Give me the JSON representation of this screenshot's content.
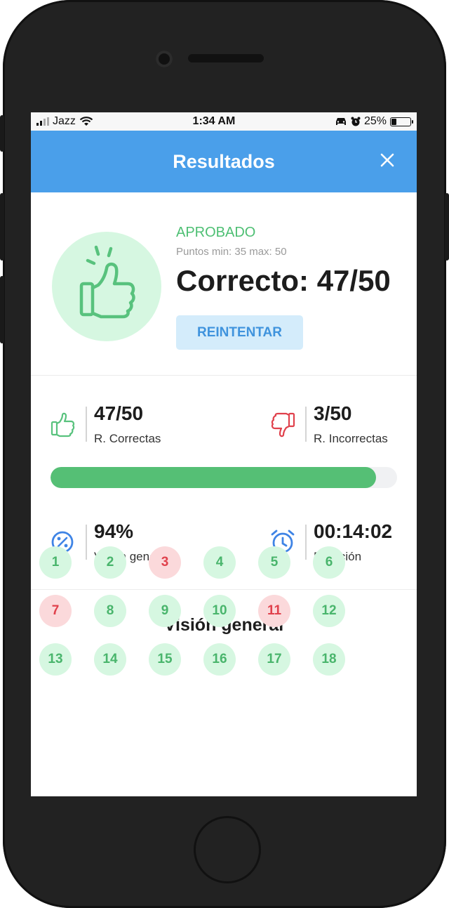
{
  "statusbar": {
    "carrier": "Jazz",
    "time": "1:34 AM",
    "battery": "25%",
    "battery_level": 0.25
  },
  "header": {
    "title": "Resultados",
    "close_icon": "close-icon"
  },
  "result": {
    "status": "APROBADO",
    "points": "Puntos min: 35 max: 50",
    "score": "Correcto: 47/50",
    "retry_label": "REINTENTAR",
    "icon": "thumbs-up-icon"
  },
  "stats": {
    "correct": {
      "value": "47/50",
      "label": "R. Correctas",
      "icon": "thumbs-up-icon"
    },
    "incorrect": {
      "value": "3/50",
      "label": "R. Incorrectas",
      "icon": "thumbs-down-icon"
    },
    "progress": 0.94,
    "overview": {
      "value": "94%",
      "label": "Visión general",
      "icon": "percent-icon"
    },
    "duration": {
      "value": "00:14:02",
      "label": "Duración",
      "icon": "alarm-clock-icon"
    }
  },
  "overview": {
    "title": "Visión general",
    "questions": [
      {
        "n": "1",
        "status": "correct"
      },
      {
        "n": "2",
        "status": "correct"
      },
      {
        "n": "3",
        "status": "incorrect"
      },
      {
        "n": "4",
        "status": "correct"
      },
      {
        "n": "5",
        "status": "correct"
      },
      {
        "n": "6",
        "status": "correct"
      },
      {
        "n": "7",
        "status": "incorrect"
      },
      {
        "n": "8",
        "status": "correct"
      },
      {
        "n": "9",
        "status": "correct"
      },
      {
        "n": "10",
        "status": "correct"
      },
      {
        "n": "11",
        "status": "incorrect"
      },
      {
        "n": "12",
        "status": "correct"
      },
      {
        "n": "13",
        "status": "correct"
      },
      {
        "n": "14",
        "status": "correct"
      },
      {
        "n": "15",
        "status": "correct"
      },
      {
        "n": "16",
        "status": "correct"
      },
      {
        "n": "17",
        "status": "correct"
      },
      {
        "n": "18",
        "status": "correct"
      }
    ]
  },
  "colors": {
    "header": "#4a9fea",
    "success": "#4dbf73",
    "danger": "#e0414c",
    "accent_blue": "#3f84e5"
  }
}
